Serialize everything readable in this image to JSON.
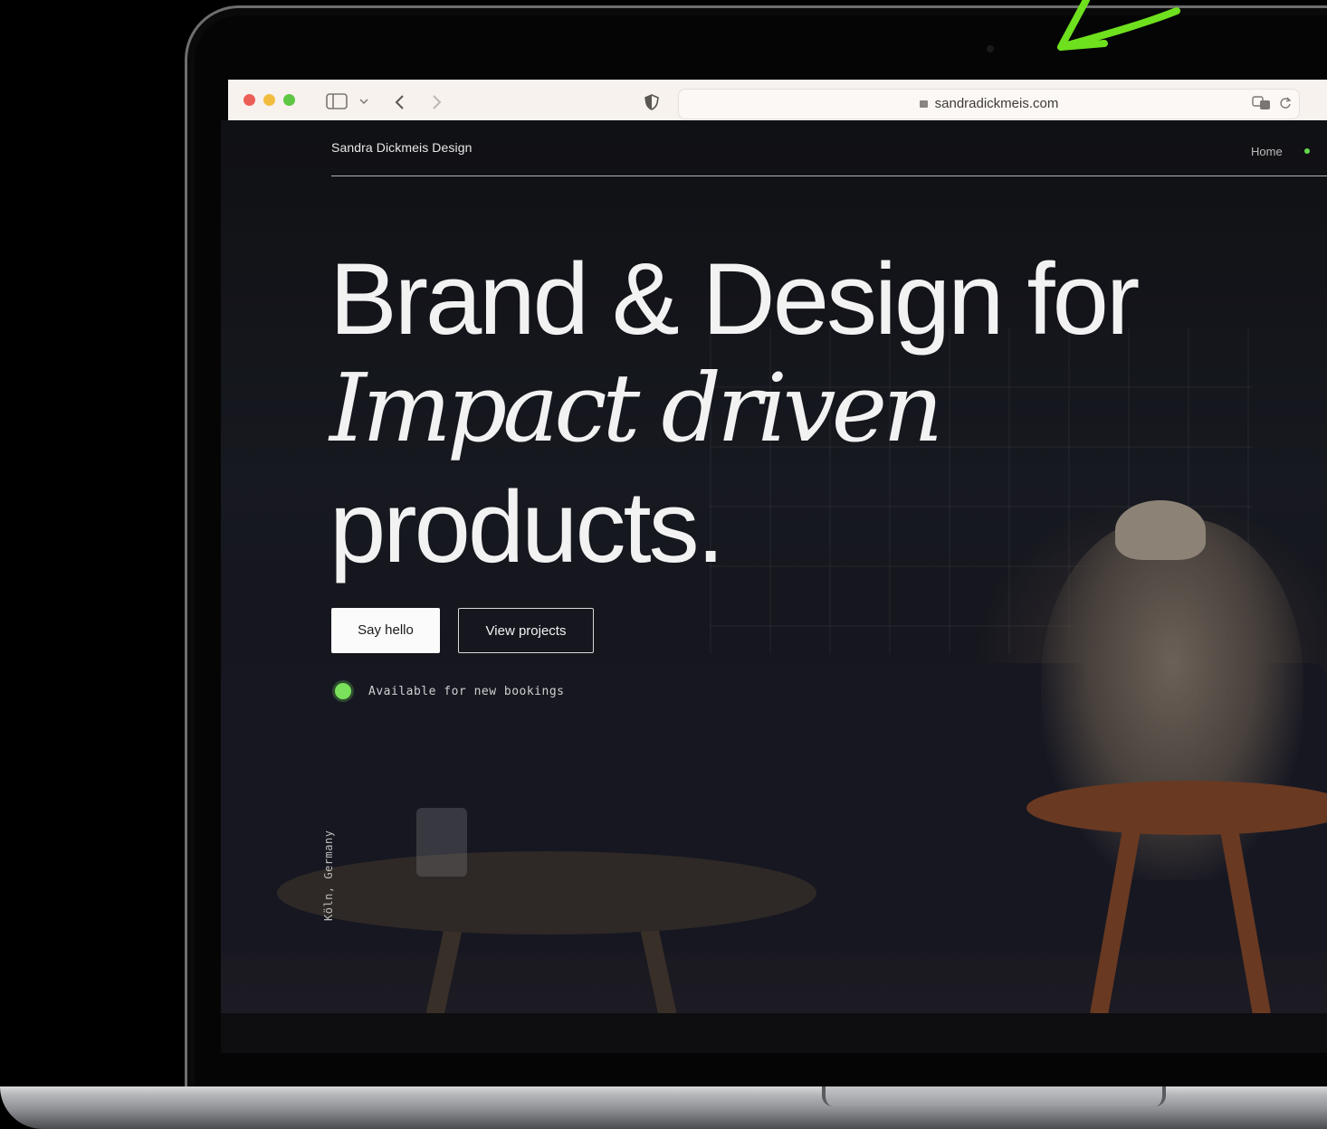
{
  "browser": {
    "url": "sandradickmeis.com",
    "icons": [
      "sidebar-icon",
      "chevron-down-icon",
      "back-icon",
      "forward-icon",
      "shield-icon",
      "lock-icon",
      "translate-icon",
      "reload-icon"
    ]
  },
  "site": {
    "brand": "Sandra Dickmeis Design",
    "nav": {
      "home": "Home"
    },
    "hero": {
      "line1": "Brand & Design for",
      "line2": "Impact driven",
      "line3": "products."
    },
    "buttons": {
      "say_hello": "Say hello",
      "view_projects": "View projects"
    },
    "availability": "Available for new bookings",
    "location": "Köln, Germany"
  },
  "colors": {
    "accent_green": "#79e25a",
    "arrow_green": "#6ee01e",
    "hero_text": "#f2f2f2",
    "browser_bar": "#f7f2ee"
  }
}
